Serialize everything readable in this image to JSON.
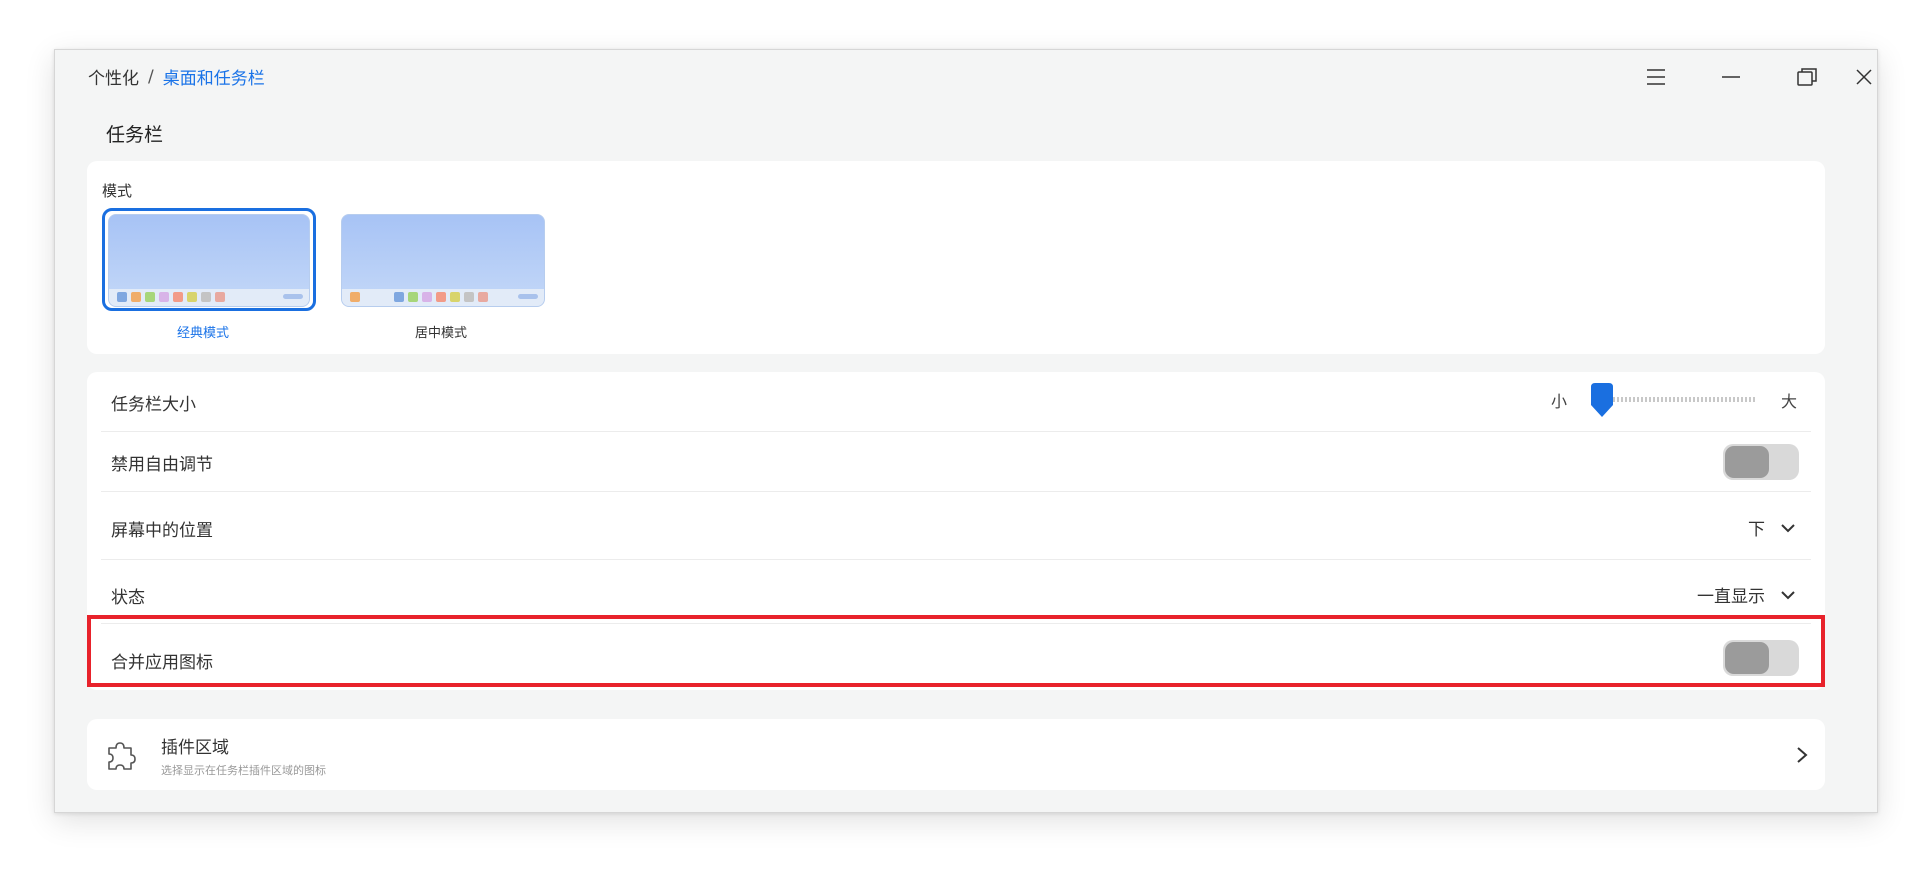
{
  "breadcrumb": {
    "parent": "个性化",
    "separator": "/",
    "current": "桌面和任务栏"
  },
  "window_controls": {
    "menu": "menu-icon",
    "minimize": "minimize-icon",
    "restore": "restore-icon",
    "close": "close-icon"
  },
  "section": {
    "title": "任务栏"
  },
  "mode": {
    "label": "模式",
    "options": [
      {
        "name": "经典模式",
        "selected": true
      },
      {
        "name": "居中模式",
        "selected": false
      }
    ]
  },
  "settings": {
    "taskbar_size": {
      "label": "任务栏大小",
      "min_label": "小",
      "max_label": "大",
      "value": 0
    },
    "disable_resize": {
      "label": "禁用自由调节",
      "enabled": false
    },
    "position": {
      "label": "屏幕中的位置",
      "value": "下"
    },
    "status": {
      "label": "状态",
      "value": "一直显示"
    },
    "merge_icons": {
      "label": "合并应用图标",
      "enabled": false
    }
  },
  "plugin_area": {
    "title": "插件区域",
    "subtitle": "选择显示在任务栏插件区域的图标",
    "icon": "puzzle-icon"
  },
  "colors": {
    "accent": "#1a73e8",
    "highlight": "#e8222b"
  }
}
